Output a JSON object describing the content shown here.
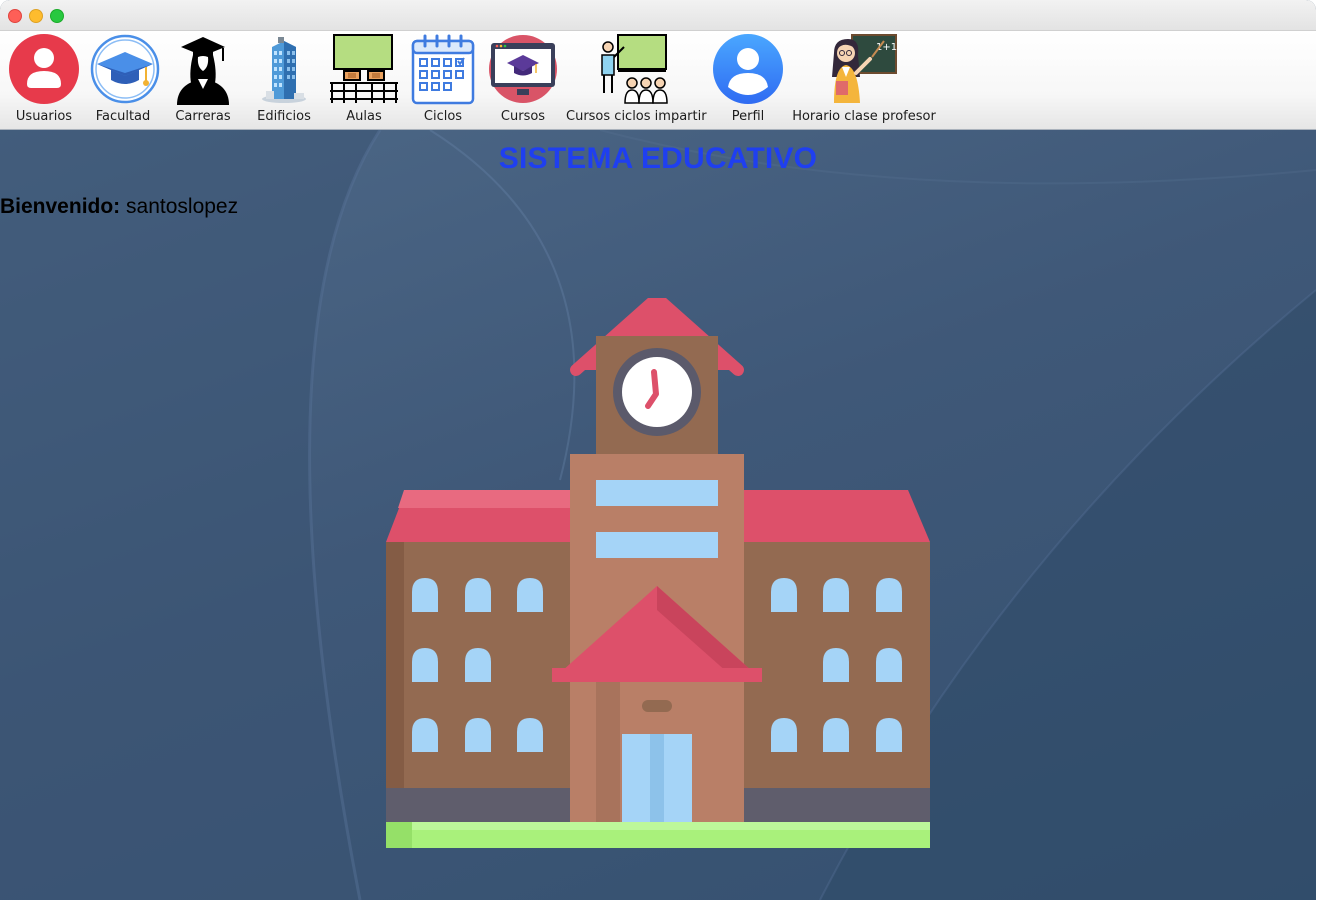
{
  "toolbar": {
    "items": [
      {
        "label": "Usuarios",
        "icon": "user-circle-icon"
      },
      {
        "label": "Facultad",
        "icon": "graduation-cap-icon"
      },
      {
        "label": "Carreras",
        "icon": "graduate-student-icon"
      },
      {
        "label": "Edificios",
        "icon": "building-icon"
      },
      {
        "label": "Aulas",
        "icon": "classroom-icon"
      },
      {
        "label": "Ciclos",
        "icon": "calendar-icon"
      },
      {
        "label": "Cursos",
        "icon": "online-course-icon"
      },
      {
        "label": "Cursos ciclos impartir",
        "icon": "teacher-lecture-icon"
      },
      {
        "label": "Perfil",
        "icon": "profile-icon"
      },
      {
        "label": "Horario clase profesor",
        "icon": "teacher-icon"
      }
    ]
  },
  "main": {
    "title": "SISTEMA EDUCATIVO",
    "welcome_label": "Bienvenido:",
    "username": "santoslopez"
  },
  "colors": {
    "title": "#1f3ff0",
    "roof": "#dd506a",
    "brick": "#936a51",
    "tower": "#b97f67",
    "window": "#a5d4f7",
    "grass": "#a9f17b",
    "background": "#3f5878"
  }
}
